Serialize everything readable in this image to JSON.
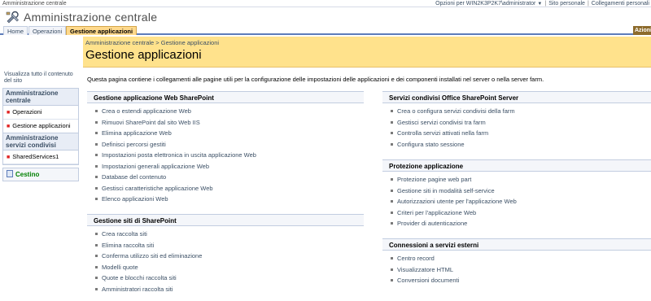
{
  "global": {
    "site_name": "Amministrazione centrale",
    "welcome": "Opzioni per WIN2K3P2K7\\administrator",
    "my_site": "Sito personale",
    "my_links": "Collegamenti personali"
  },
  "header": {
    "title": "Amministrazione centrale"
  },
  "topnav": {
    "tabs": [
      {
        "label": "Home"
      },
      {
        "label": "Operazioni"
      },
      {
        "label": "Gestione applicazioni"
      }
    ],
    "actions_label": "Azioni"
  },
  "page": {
    "breadcrumb": "Amministrazione centrale > Gestione applicazioni",
    "title": "Gestione applicazioni",
    "description": "Questa pagina contiene i collegamenti alle pagine utili per la configurazione delle impostazioni delle applicazioni e dei componenti installati nel server o nella server farm."
  },
  "leftnav": {
    "view_all": "Visualizza tutto il contenuto del sito",
    "groups": [
      {
        "header": "Amministrazione centrale",
        "items": [
          "Operazioni",
          "Gestione applicazioni"
        ]
      },
      {
        "header": "Amministrazione servizi condivisi",
        "items": [
          "SharedServices1"
        ]
      }
    ],
    "recycle_bin": "Cestino"
  },
  "sections": {
    "web_apps": {
      "header": "Gestione applicazione Web SharePoint",
      "links": [
        "Crea o estendi applicazione Web",
        "Rimuovi SharePoint dal sito Web IIS",
        "Elimina applicazione Web",
        "Definisci percorsi gestiti",
        "Impostazioni posta elettronica in uscita applicazione Web",
        "Impostazioni generali applicazione Web",
        "Database del contenuto",
        "Gestisci caratteristiche applicazione Web",
        "Elenco applicazioni Web"
      ]
    },
    "site_mgmt": {
      "header": "Gestione siti di SharePoint",
      "links": [
        "Crea raccolta siti",
        "Elimina raccolta siti",
        "Conferma utilizzo siti ed eliminazione",
        "Modelli quote",
        "Quote e blocchi raccolta siti",
        "Amministratori raccolta siti"
      ]
    },
    "shared_services": {
      "header": "Servizi condivisi Office SharePoint Server",
      "links": [
        "Crea o configura servizi condivisi della farm",
        "Gestisci servizi condivisi tra farm",
        "Controlla servizi attivati nella farm",
        "Configura stato sessione"
      ]
    },
    "app_security": {
      "header": "Protezione applicazione",
      "links": [
        "Protezione pagine web part",
        "Gestione siti in modalità self-service",
        "Autorizzazioni utente per l'applicazione Web",
        "Criteri per l'applicazione Web",
        "Provider di autenticazione"
      ]
    },
    "external": {
      "header": "Connessioni a servizi esterni",
      "links": [
        "Centro record",
        "Visualizzatore HTML",
        "Conversioni documenti"
      ]
    }
  },
  "icons": {
    "logo": "admin-tools-icon",
    "bullet": "square-bullet-icon",
    "recycle": "recycle-bin-icon"
  }
}
